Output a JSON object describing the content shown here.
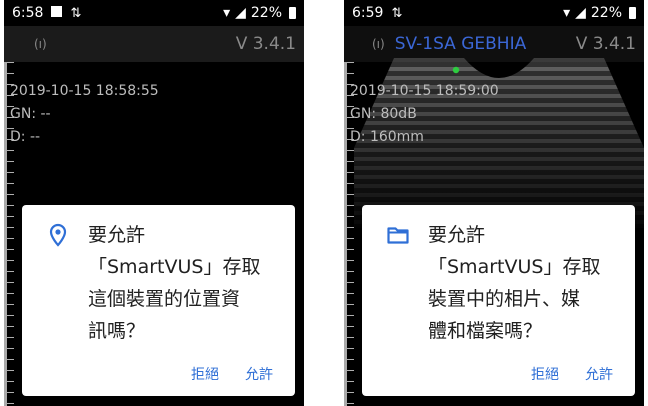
{
  "left_screen": {
    "status": {
      "time": "6:58",
      "battery": "22%"
    },
    "app": {
      "device_name": "",
      "version": "V 3.4.1"
    },
    "info": {
      "datetime": "2019-10-15 18:58:55",
      "gain": "GN: --",
      "depth": "D: --"
    },
    "dialog": {
      "icon": "location-pin-icon",
      "line1": "要允許",
      "line2": "「SmartVUS」存取",
      "line3": "這個裝置的位置資",
      "line4": "訊嗎？",
      "deny_label": "拒絕",
      "allow_label": "允許"
    }
  },
  "right_screen": {
    "status": {
      "time": "6:59",
      "battery": "22%"
    },
    "app": {
      "device_name": "SV-1SA GEBHIA",
      "version": "V 3.4.1"
    },
    "info": {
      "datetime": "2019-10-15 18:59:00",
      "gain": "GN: 80dB",
      "depth": "D: 160mm"
    },
    "dialog": {
      "icon": "folder-icon",
      "line1": "要允許",
      "line2": "「SmartVUS」存取",
      "line3": "裝置中的相片、媒",
      "line4": "體和檔案嗎？",
      "deny_label": "拒絕",
      "allow_label": "允許"
    }
  },
  "colors": {
    "accent": "#2f6fd6",
    "device_name": "#3b67d6",
    "version": "#8a8a8a",
    "background": "#000000"
  }
}
